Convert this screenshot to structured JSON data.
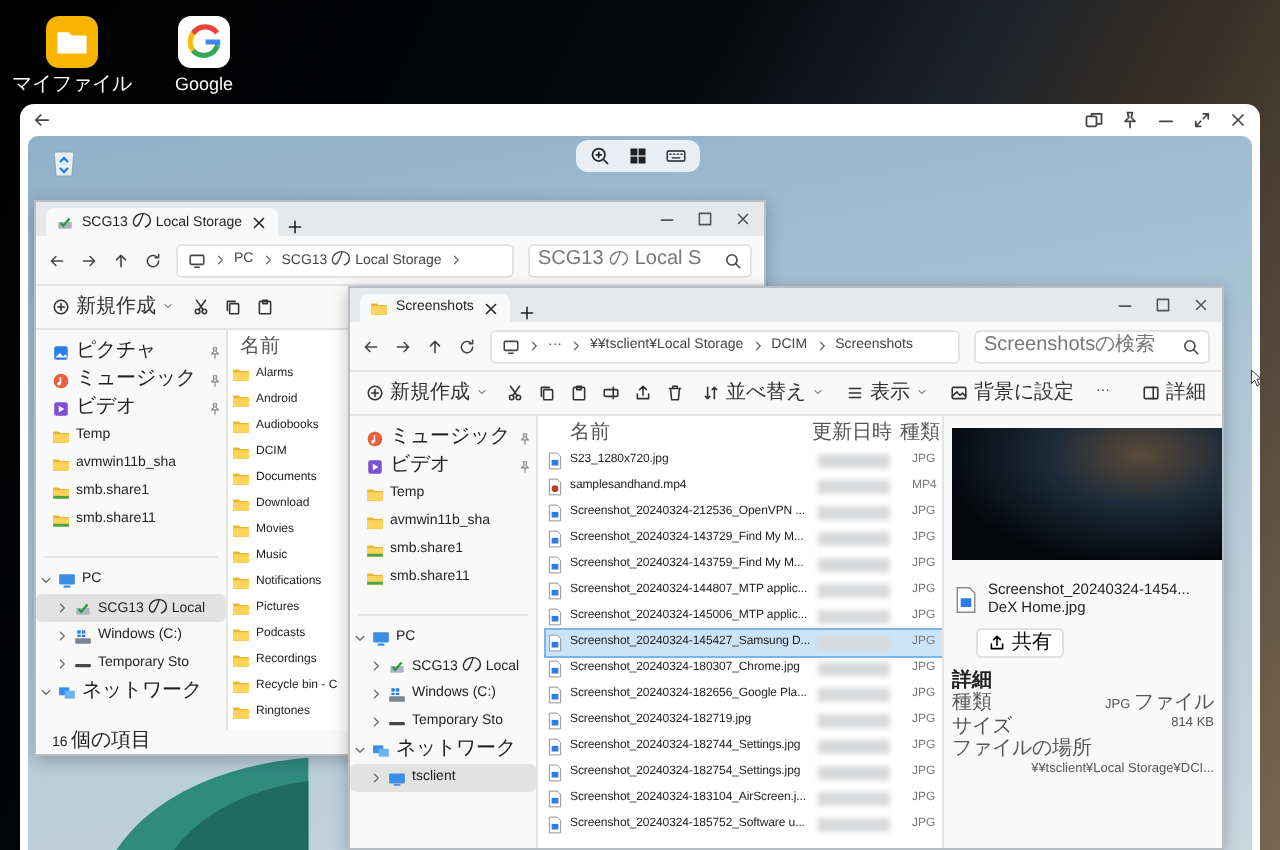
{
  "desktop_icons": [
    {
      "label": "マイファイル",
      "kind": "files"
    },
    {
      "label": "Google",
      "kind": "google"
    }
  ],
  "back_window": {
    "tab": {
      "title": "SCG13 の Local Storage"
    },
    "address": [
      "PC",
      "SCG13 の Local Storage"
    ],
    "search": {
      "placeholder": "SCG13 の Local S"
    },
    "toolbar": {
      "new": "新規作成"
    },
    "quick_access": [
      {
        "label": "ピクチャ",
        "kind": "pictures",
        "pinned": true
      },
      {
        "label": "ミュージック",
        "kind": "music",
        "pinned": true
      },
      {
        "label": "ビデオ",
        "kind": "videos",
        "pinned": true
      },
      {
        "label": "Temp",
        "kind": "folder",
        "pinned": false
      },
      {
        "label": "avmwin11b_sha",
        "kind": "folder",
        "pinned": false
      },
      {
        "label": "smb.share1",
        "kind": "share",
        "pinned": false
      },
      {
        "label": "smb.share11",
        "kind": "share",
        "pinned": false
      }
    ],
    "tree": [
      {
        "label": "PC",
        "kind": "pc",
        "expanded": true,
        "selected": false,
        "children": [
          {
            "label": "SCG13 の Local",
            "kind": "phone",
            "expanded": false,
            "selected": true
          },
          {
            "label": "Windows (C:)",
            "kind": "windows_drive",
            "expanded": false,
            "selected": false
          },
          {
            "label": "Temporary Sto",
            "kind": "usb_drive",
            "expanded": false,
            "selected": false
          }
        ]
      },
      {
        "label": "ネットワーク",
        "kind": "network",
        "expanded": true,
        "selected": false
      }
    ],
    "column": "名前",
    "folders": [
      "Alarms",
      "Android",
      "Audiobooks",
      "DCIM",
      "Documents",
      "Download",
      "Movies",
      "Music",
      "Notifications",
      "Pictures",
      "Podcasts",
      "Recordings",
      "Recycle bin - C",
      "Ringtones"
    ],
    "status": "16 個の項目"
  },
  "front_window": {
    "tab": {
      "title": "Screenshots"
    },
    "address": [
      "···",
      "¥¥tsclient¥Local Storage",
      "DCIM",
      "Screenshots"
    ],
    "search": {
      "placeholder": "Screenshotsの検索"
    },
    "toolbar": {
      "new": "新規作成",
      "sort": "並べ替え",
      "view": "表示",
      "set_background": "背景に設定",
      "more": "···",
      "details": "詳細"
    },
    "quick_access": [
      {
        "label": "ミュージック",
        "kind": "music",
        "pinned": true
      },
      {
        "label": "ビデオ",
        "kind": "videos",
        "pinned": true
      },
      {
        "label": "Temp",
        "kind": "folder",
        "pinned": false
      },
      {
        "label": "avmwin11b_sha",
        "kind": "folder",
        "pinned": false
      },
      {
        "label": "smb.share1",
        "kind": "share",
        "pinned": false
      },
      {
        "label": "smb.share11",
        "kind": "share",
        "pinned": false
      }
    ],
    "tree": [
      {
        "label": "PC",
        "kind": "pc",
        "expanded": true,
        "selected": false,
        "children": [
          {
            "label": "SCG13 の Local",
            "kind": "phone",
            "expanded": false,
            "selected": false
          },
          {
            "label": "Windows (C:)",
            "kind": "windows_drive",
            "expanded": false,
            "selected": false
          },
          {
            "label": "Temporary Sto",
            "kind": "usb_drive",
            "expanded": false,
            "selected": false
          }
        ]
      },
      {
        "label": "ネットワーク",
        "kind": "network",
        "expanded": true,
        "selected": false,
        "children": [
          {
            "label": "tsclient",
            "kind": "network_share",
            "expanded": false,
            "selected": true
          }
        ]
      }
    ],
    "columns": [
      "名前",
      "更新日時",
      "種類"
    ],
    "files": [
      {
        "name": "S23_1280x720.jpg",
        "type": "JPG",
        "kind": "image",
        "selected": false
      },
      {
        "name": "samplesandhand.mp4",
        "type": "MP4",
        "kind": "video",
        "selected": false
      },
      {
        "name": "Screenshot_20240324-212536_OpenVPN ...",
        "type": "JPG",
        "kind": "image",
        "selected": false
      },
      {
        "name": "Screenshot_20240324-143729_Find My M...",
        "type": "JPG",
        "kind": "image",
        "selected": false
      },
      {
        "name": "Screenshot_20240324-143759_Find My M...",
        "type": "JPG",
        "kind": "image",
        "selected": false
      },
      {
        "name": "Screenshot_20240324-144807_MTP applic...",
        "type": "JPG",
        "kind": "image",
        "selected": false
      },
      {
        "name": "Screenshot_20240324-145006_MTP applic...",
        "type": "JPG",
        "kind": "image",
        "selected": false
      },
      {
        "name": "Screenshot_20240324-145427_Samsung D...",
        "type": "JPG",
        "kind": "image",
        "selected": true
      },
      {
        "name": "Screenshot_20240324-180307_Chrome.jpg",
        "type": "JPG",
        "kind": "image",
        "selected": false
      },
      {
        "name": "Screenshot_20240324-182656_Google Pla...",
        "type": "JPG",
        "kind": "image",
        "selected": false
      },
      {
        "name": "Screenshot_20240324-182719.jpg",
        "type": "JPG",
        "kind": "image",
        "selected": false
      },
      {
        "name": "Screenshot_20240324-182744_Settings.jpg",
        "type": "JPG",
        "kind": "image",
        "selected": false
      },
      {
        "name": "Screenshot_20240324-182754_Settings.jpg",
        "type": "JPG",
        "kind": "image",
        "selected": false
      },
      {
        "name": "Screenshot_20240324-183104_AirScreen.j...",
        "type": "JPG",
        "kind": "image",
        "selected": false
      },
      {
        "name": "Screenshot_20240324-185752_Software u...",
        "type": "JPG",
        "kind": "image",
        "selected": false
      }
    ],
    "preview": {
      "file_name": [
        "Screenshot_20240324-1454...",
        "DeX Home.jpg"
      ],
      "share": "共有",
      "details_heading": "詳細",
      "properties": [
        {
          "label": "種類",
          "value": "JPG ファイル"
        },
        {
          "label": "サイズ",
          "value": "814 KB"
        },
        {
          "label": "ファイルの場所",
          "value": "¥¥tsclient¥Local Storage¥DCI..."
        }
      ]
    }
  }
}
